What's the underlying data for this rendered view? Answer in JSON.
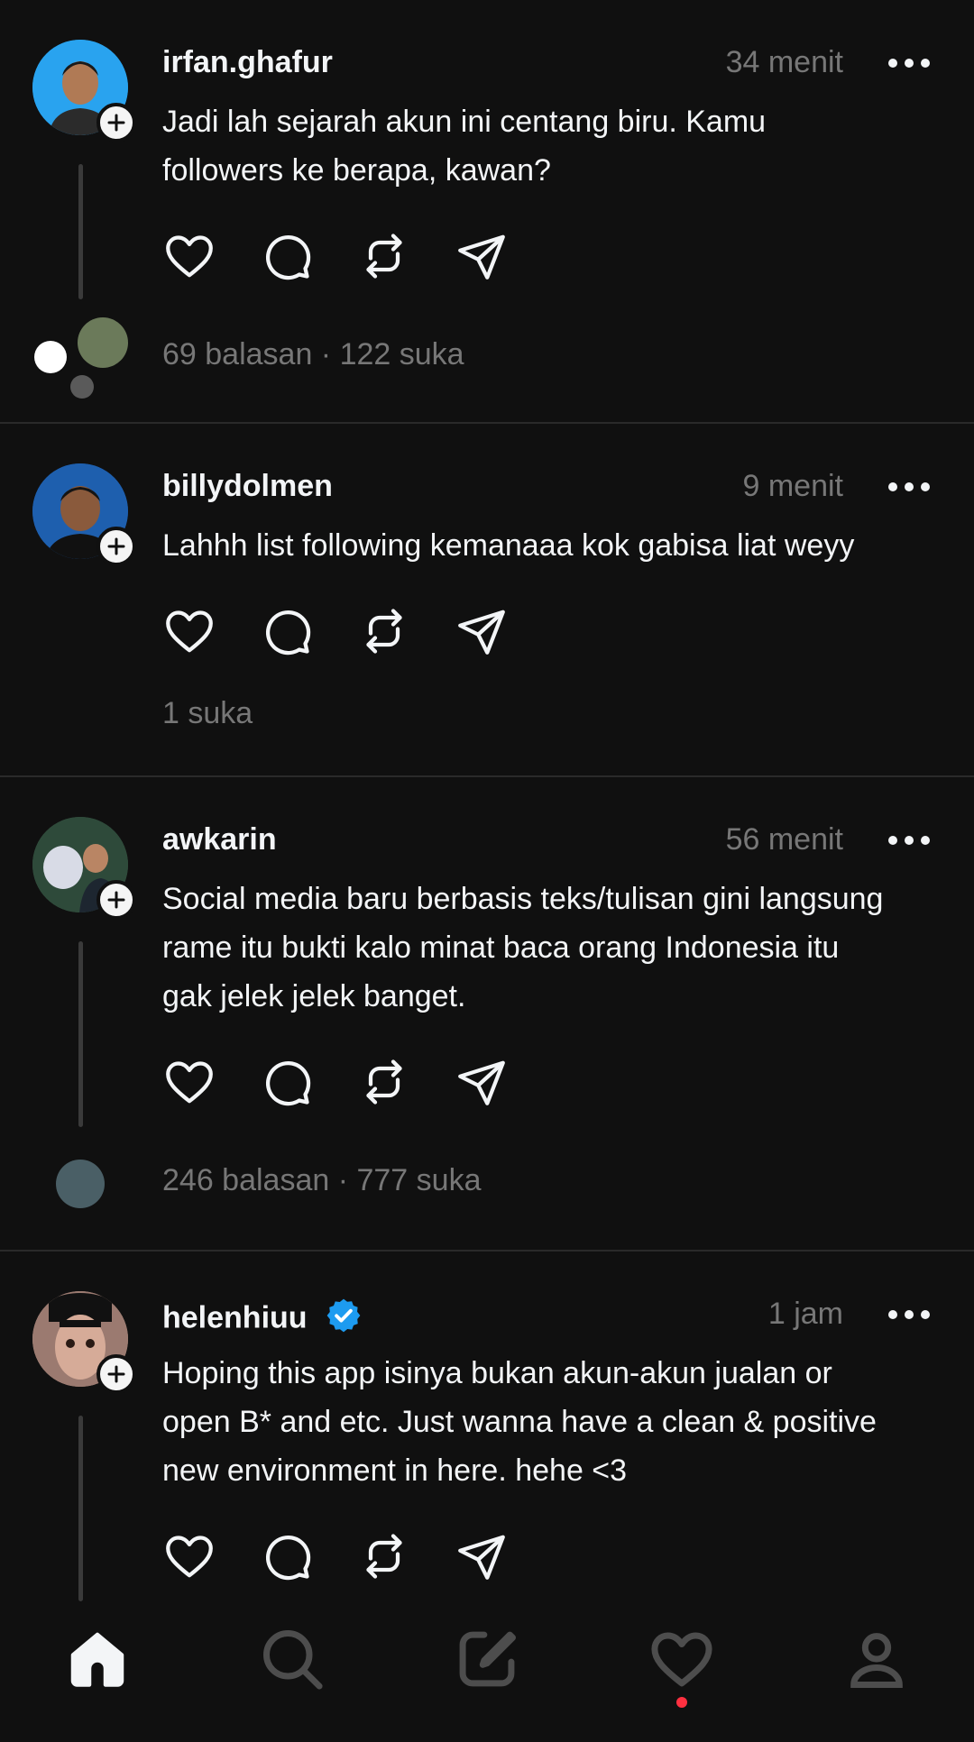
{
  "posts": [
    {
      "username": "irfan.ghafur",
      "time": "34 menit",
      "text_lines": [
        "Jadi lah sejarah akun ini centang biru. Kamu",
        "followers ke berapa, kawan?"
      ],
      "stats": "69 balasan · 122 suka",
      "avatar_color": "#29a3ef"
    },
    {
      "username": "billydolmen",
      "time": "9 menit",
      "text_lines": [
        "Lahhh list following kemanaaa kok gabisa liat weyy"
      ],
      "stats": "1 suka",
      "avatar_color": "#1e5fae"
    },
    {
      "username": "awkarin",
      "time": "56 menit",
      "text_lines": [
        "Social media baru berbasis teks/tulisan gini langsung",
        "rame itu bukti kalo minat baca orang Indonesia itu",
        "gak jelek jelek banget."
      ],
      "stats": "246 balasan · 777 suka",
      "avatar_color": "#3c5a48"
    },
    {
      "username": "helenhiuu",
      "time": "1 jam",
      "verified": true,
      "text_lines": [
        "Hoping this app isinya bukan akun-akun jualan or",
        "open B* and etc. Just wanna have a clean & positive",
        "new environment in here. hehe <3"
      ],
      "avatar_color": "#c9a394"
    }
  ],
  "nav": {
    "items": [
      "home-icon",
      "search-icon",
      "compose-icon",
      "activity-heart-icon",
      "profile-icon"
    ],
    "active": "home-icon",
    "notification_dot_color": "#ff3040"
  },
  "colors": {
    "background": "#101010",
    "primary_text": "#f3f5f7",
    "secondary_text": "#777777",
    "verified_blue": "#1d9bf0"
  }
}
